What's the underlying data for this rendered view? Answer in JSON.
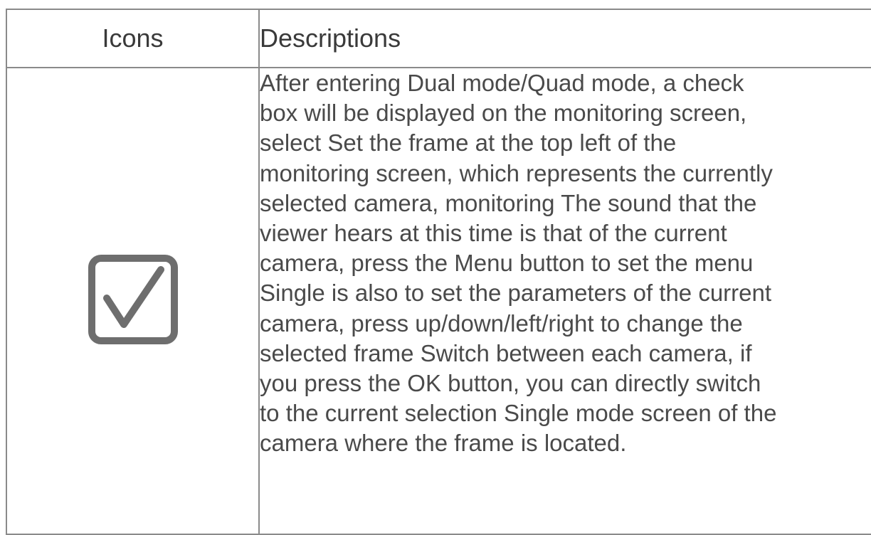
{
  "table": {
    "headers": {
      "icons": "Icons",
      "descriptions": "Descriptions"
    },
    "rows": [
      {
        "icon": "checked-checkbox-icon",
        "description_lines": [
          "After entering Dual mode/Quad mode, a check",
          "box will be displayed on the monitoring screen,",
          "select Set the frame at the top left of the",
          "monitoring screen, which represents the currently",
          "selected camera, monitoring The sound that the",
          "viewer hears at this time is that of the current",
          "camera, press the Menu button to set the menu",
          "Single is also to set the parameters of the current",
          "camera, press up/down/left/right to change the",
          "selected frame Switch between each camera, if",
          "you press the OK button, you can directly switch",
          "to the current selection Single mode screen of the",
          "camera where the frame is located."
        ]
      }
    ]
  },
  "colors": {
    "border": "#8a8a8a",
    "text": "#4a4a4a",
    "icon": "#6e6e6e"
  }
}
